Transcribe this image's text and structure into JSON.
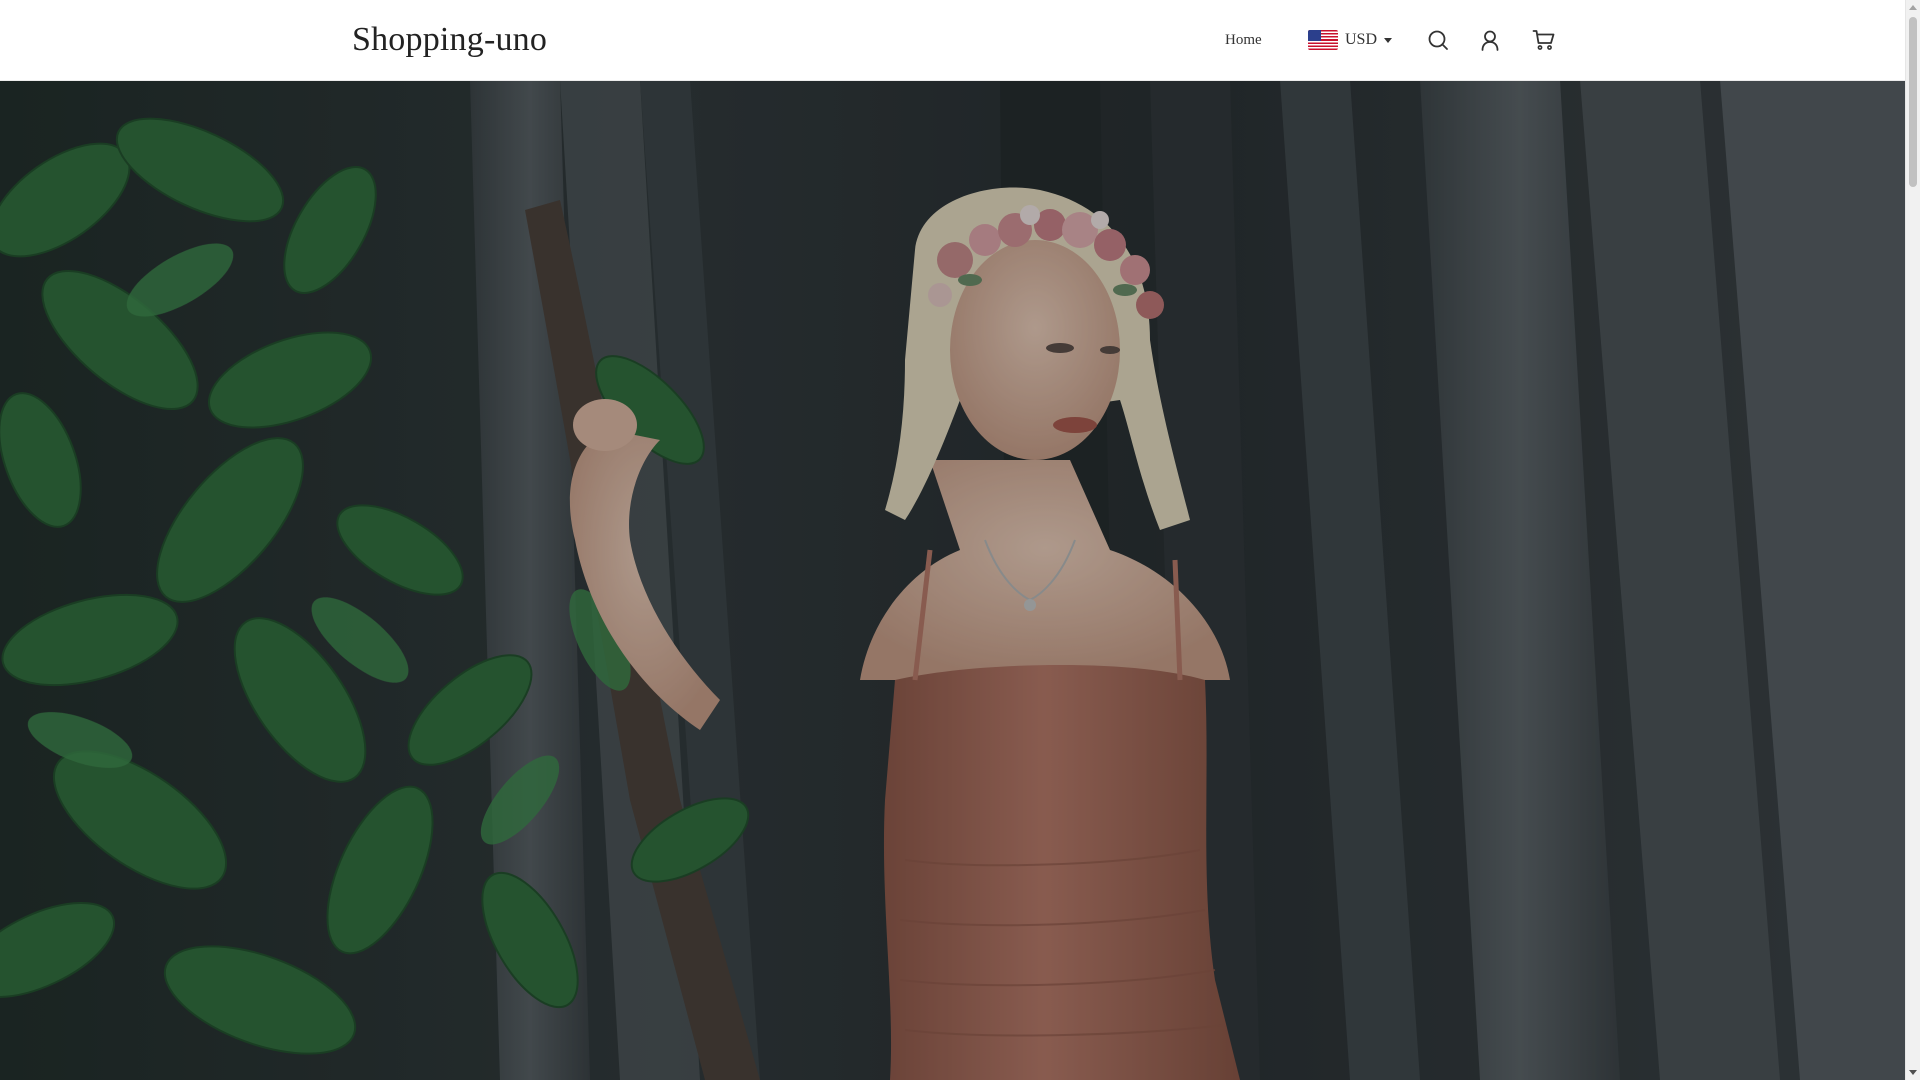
{
  "header": {
    "logo": "Shopping-uno",
    "nav": {
      "home": "Home"
    },
    "currency": {
      "code": "USD",
      "flag_icon": "us-flag-icon"
    },
    "icons": [
      "search-icon",
      "user-icon",
      "cart-icon"
    ]
  },
  "hero": {
    "image_description_icon": "hero-photo",
    "colors": {
      "overlay": "#000000",
      "leaf": "#2f6b3a",
      "trunk": "#4a4f53",
      "dress": "#b87766",
      "hair": "#e8dcc0",
      "skin": "#e6c2ae"
    }
  },
  "theme": {
    "header_bg": "#ffffff",
    "text": "#333333",
    "logo_color": "#222222"
  }
}
